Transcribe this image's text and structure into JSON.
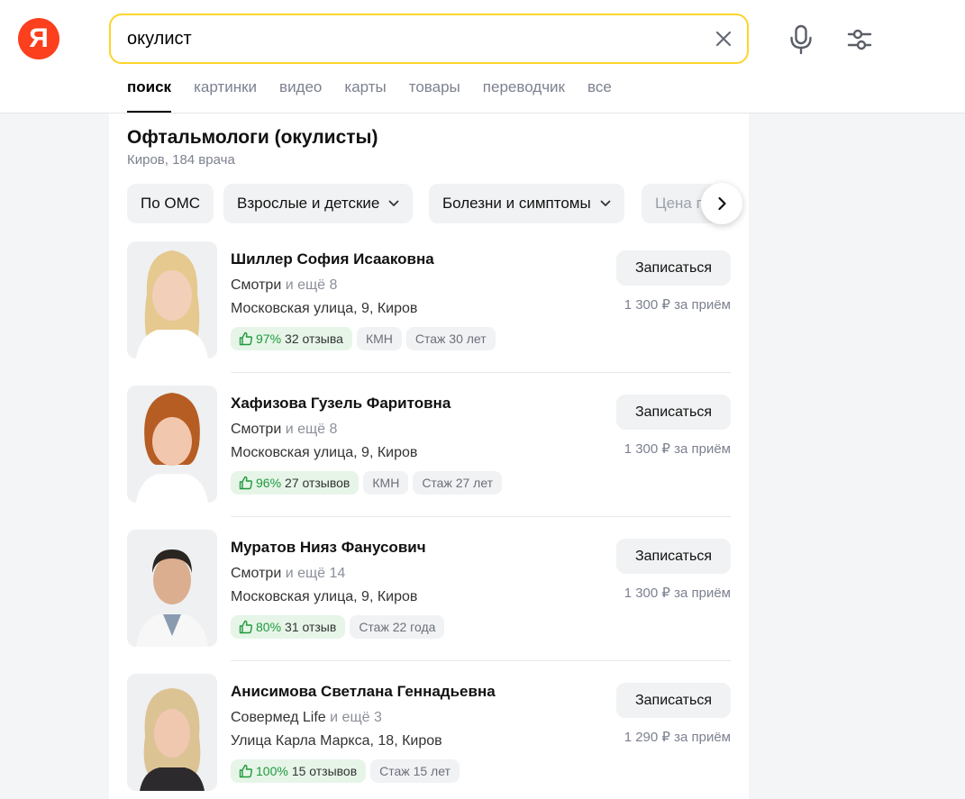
{
  "header": {
    "logo": "Я",
    "search": {
      "value": "окулист",
      "placeholder": ""
    },
    "icons": {
      "clear": "close-icon",
      "mic": "microphone-icon",
      "settings": "filter-settings-icon"
    },
    "brand_colors": {
      "logo": "#fc3f1d",
      "search_border": "#fed42b"
    }
  },
  "tabs": [
    {
      "label": "поиск",
      "active": true
    },
    {
      "label": "картинки"
    },
    {
      "label": "видео"
    },
    {
      "label": "карты"
    },
    {
      "label": "товары"
    },
    {
      "label": "переводчик"
    },
    {
      "label": "все"
    }
  ],
  "card": {
    "title": "Офтальмологи (окулисты)",
    "subtitle": "Киров, 184 врача",
    "filters": [
      {
        "label": "По ОМС"
      },
      {
        "label": "Взрослые и детские"
      },
      {
        "label": "Болезни и симптомы"
      },
      {
        "label": "Цена п"
      }
    ],
    "doctors": [
      {
        "name": "Шиллер София Исааковна",
        "clinic": "Смотри",
        "more": "и ещё 8",
        "address": "Московская улица, 9, Киров",
        "rating_pct": "97%",
        "reviews": "32 отзыва",
        "degree": "КМН",
        "experience": "Стаж 30 лет",
        "book_label": "Записаться",
        "price": "1 300 ₽ за приём"
      },
      {
        "name": "Хафизова Гузель Фаритовна",
        "clinic": "Смотри",
        "more": "и ещё 8",
        "address": "Московская улица, 9, Киров",
        "rating_pct": "96%",
        "reviews": "27 отзывов",
        "degree": "КМН",
        "experience": "Стаж 27 лет",
        "book_label": "Записаться",
        "price": "1 300 ₽ за приём"
      },
      {
        "name": "Муратов Нияз Фанусович",
        "clinic": "Смотри",
        "more": "и ещё 14",
        "address": "Московская улица, 9, Киров",
        "rating_pct": "80%",
        "reviews": "31 отзыв",
        "experience": "Стаж 22 года",
        "book_label": "Записаться",
        "price": "1 300 ₽ за приём"
      },
      {
        "name": "Анисимова Светлана Геннадьевна",
        "clinic": "Совермед Life",
        "more": "и ещё 3",
        "address": "Улица Карла Маркса, 18, Киров",
        "rating_pct": "100%",
        "reviews": "15 отзывов",
        "experience": "Стаж 15 лет",
        "book_label": "Записаться",
        "price": "1 290 ₽ за приём"
      }
    ]
  }
}
